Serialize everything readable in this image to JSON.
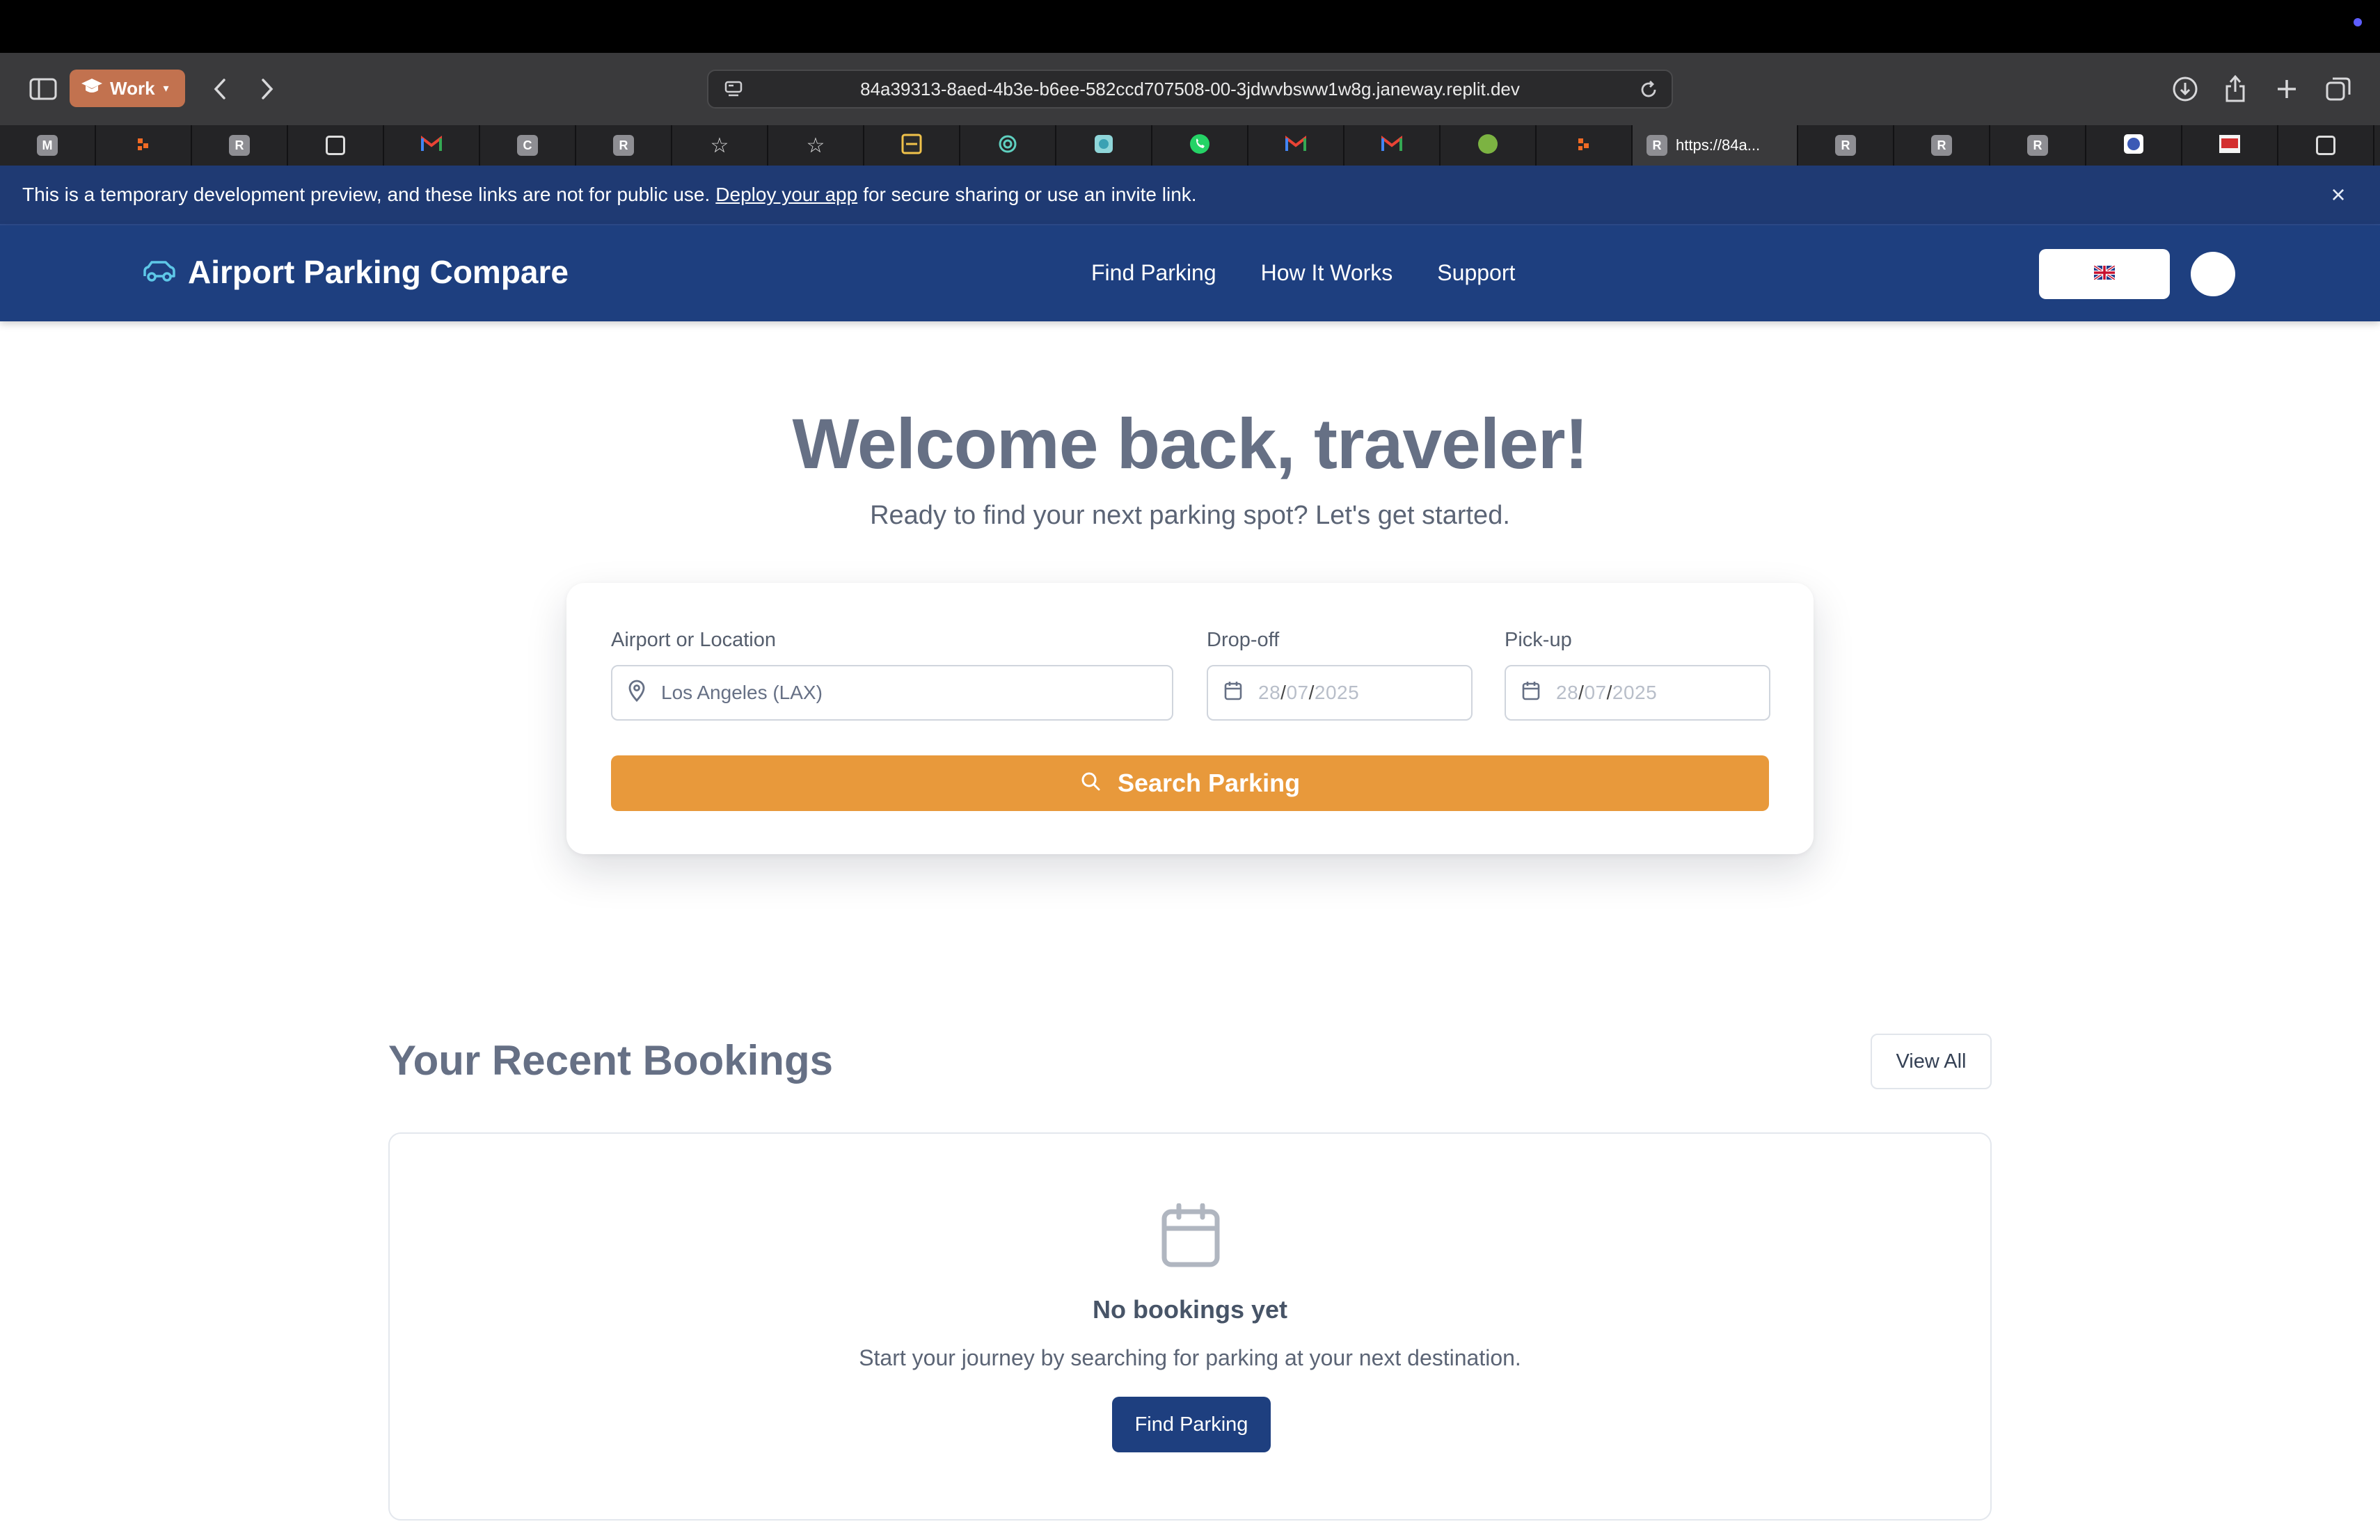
{
  "browser": {
    "profile_label": "Work",
    "url": "84a39313-8aed-4b3e-b6ee-582ccd707508-00-3jdwvbsww1w8g.janeway.replit.dev",
    "active_tab_title": "https://84a...",
    "tab_letters": {
      "m": "M",
      "r": "R",
      "c": "C"
    }
  },
  "dev_banner": {
    "text_before": "This is a temporary development preview, and these links are not for public use.",
    "link": "Deploy your app",
    "text_after": "for secure sharing or use an invite link.",
    "close_icon": "×"
  },
  "header": {
    "brand": "Airport Parking Compare",
    "nav": [
      "Find Parking",
      "How It Works",
      "Support"
    ],
    "language_flag": "🇬🇧"
  },
  "hero": {
    "title": "Welcome back, traveler!",
    "subtitle": "Ready to find your next parking spot? Let's get started."
  },
  "search": {
    "location_label": "Airport or Location",
    "location_value": "Los Angeles (LAX)",
    "dropoff_label": "Drop-off",
    "dropoff": {
      "dd": "28",
      "mm": "07",
      "yyyy": "2025",
      "sep": "/"
    },
    "pickup_label": "Pick-up",
    "pickup": {
      "dd": "28",
      "mm": "07",
      "yyyy": "2025",
      "sep": "/"
    },
    "button_label": "Search Parking"
  },
  "recent": {
    "title": "Your Recent Bookings",
    "view_all_label": "View All",
    "empty_title": "No bookings yet",
    "empty_text": "Start your journey by searching for parking at your next destination.",
    "find_button_label": "Find Parking"
  },
  "colors": {
    "header_bg": "#1e3f7f",
    "banner_bg": "#1f3a73",
    "accent_orange": "#e8993b",
    "heading_gray": "#667085"
  }
}
